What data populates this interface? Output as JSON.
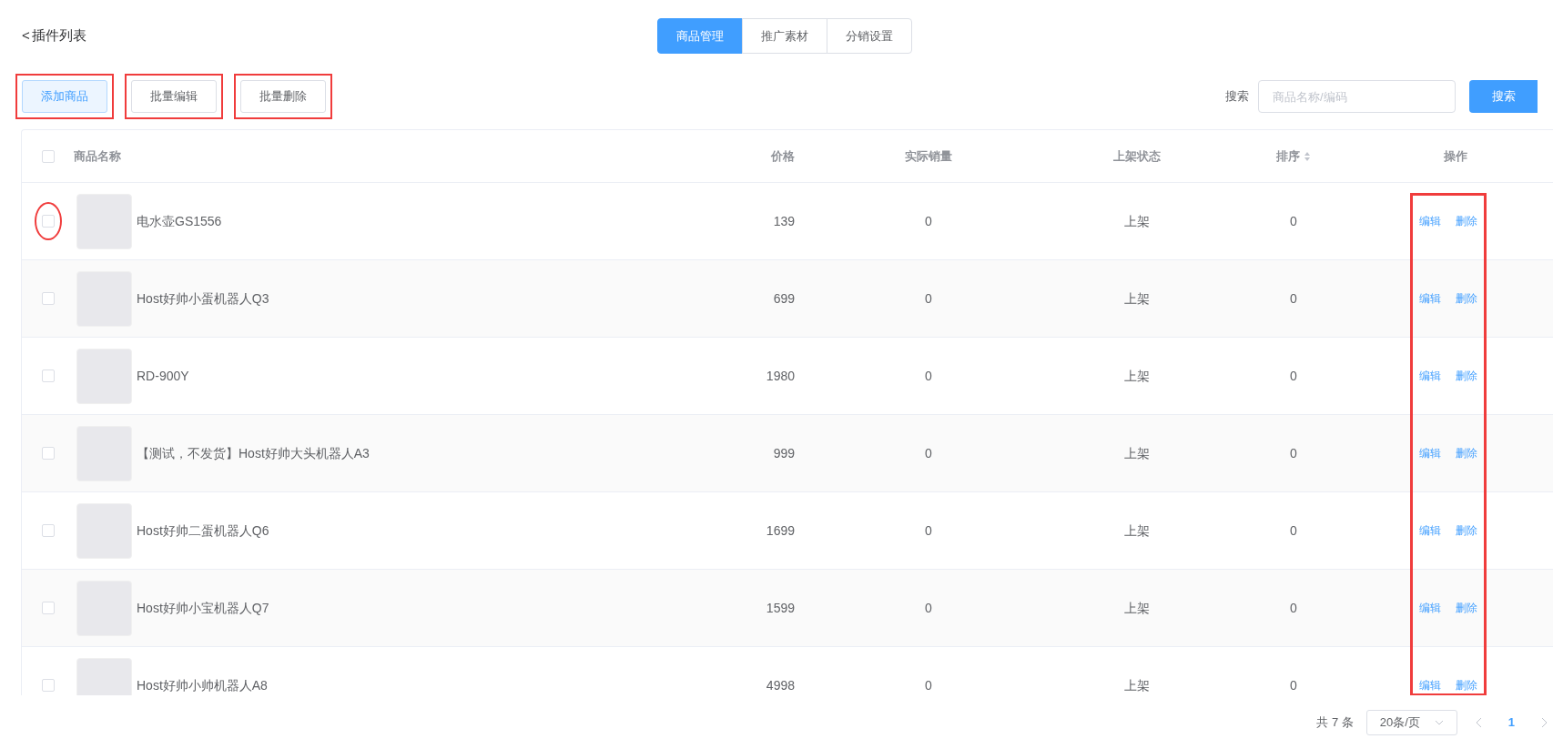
{
  "back_link": {
    "icon": "<",
    "label": "插件列表"
  },
  "tabs": [
    {
      "label": "商品管理",
      "selected": true
    },
    {
      "label": "推广素材",
      "selected": false
    },
    {
      "label": "分销设置",
      "selected": false
    }
  ],
  "toolbar": {
    "buttons": [
      {
        "label": "添加商品",
        "kind": "primary",
        "highlighted": true
      },
      {
        "label": "批量编辑",
        "kind": "default",
        "highlighted": true
      },
      {
        "label": "批量删除",
        "kind": "default",
        "highlighted": true
      }
    ],
    "search_label": "搜索",
    "search": {
      "placeholder": "商品名称/编码"
    },
    "search_button": "搜索"
  },
  "table": {
    "header_checked": false,
    "actions_column_highlighted": true,
    "columns": [
      {
        "label": "商品名称",
        "sortable": false
      },
      {
        "label": "价格",
        "sortable": false
      },
      {
        "label": "实际销量",
        "sortable": false
      },
      {
        "label": "上架状态",
        "sortable": false
      },
      {
        "label": "排序",
        "sortable": true
      },
      {
        "label": "操作",
        "sortable": false
      }
    ],
    "rows": [
      {
        "checked": false,
        "circled": true,
        "name": "电水壶GS1556",
        "price": "139",
        "sales": "0",
        "status": "上架",
        "sort": "0",
        "actions": [
          "编辑",
          "删除"
        ]
      },
      {
        "checked": false,
        "circled": false,
        "name": "Host好帅小蛋机器人Q3",
        "price": "699",
        "sales": "0",
        "status": "上架",
        "sort": "0",
        "actions": [
          "编辑",
          "删除"
        ]
      },
      {
        "checked": false,
        "circled": false,
        "name": "RD-900Y",
        "price": "1980",
        "sales": "0",
        "status": "上架",
        "sort": "0",
        "actions": [
          "编辑",
          "删除"
        ]
      },
      {
        "checked": false,
        "circled": false,
        "name": "【测试，不发货】Host好帅大头机器人A3",
        "price": "999",
        "sales": "0",
        "status": "上架",
        "sort": "0",
        "actions": [
          "编辑",
          "删除"
        ]
      },
      {
        "checked": false,
        "circled": false,
        "name": "Host好帅二蛋机器人Q6",
        "price": "1699",
        "sales": "0",
        "status": "上架",
        "sort": "0",
        "actions": [
          "编辑",
          "删除"
        ]
      },
      {
        "checked": false,
        "circled": false,
        "name": "Host好帅小宝机器人Q7",
        "price": "1599",
        "sales": "0",
        "status": "上架",
        "sort": "0",
        "actions": [
          "编辑",
          "删除"
        ]
      },
      {
        "checked": false,
        "circled": false,
        "name": "Host好帅小帅机器人A8",
        "price": "4998",
        "sales": "0",
        "status": "上架",
        "sort": "0",
        "actions": [
          "编辑",
          "删除"
        ]
      }
    ]
  },
  "pagination": {
    "total": "共 7 条",
    "page_size": "20条/页",
    "pages": [
      {
        "label": "1",
        "selected": true
      }
    ]
  }
}
